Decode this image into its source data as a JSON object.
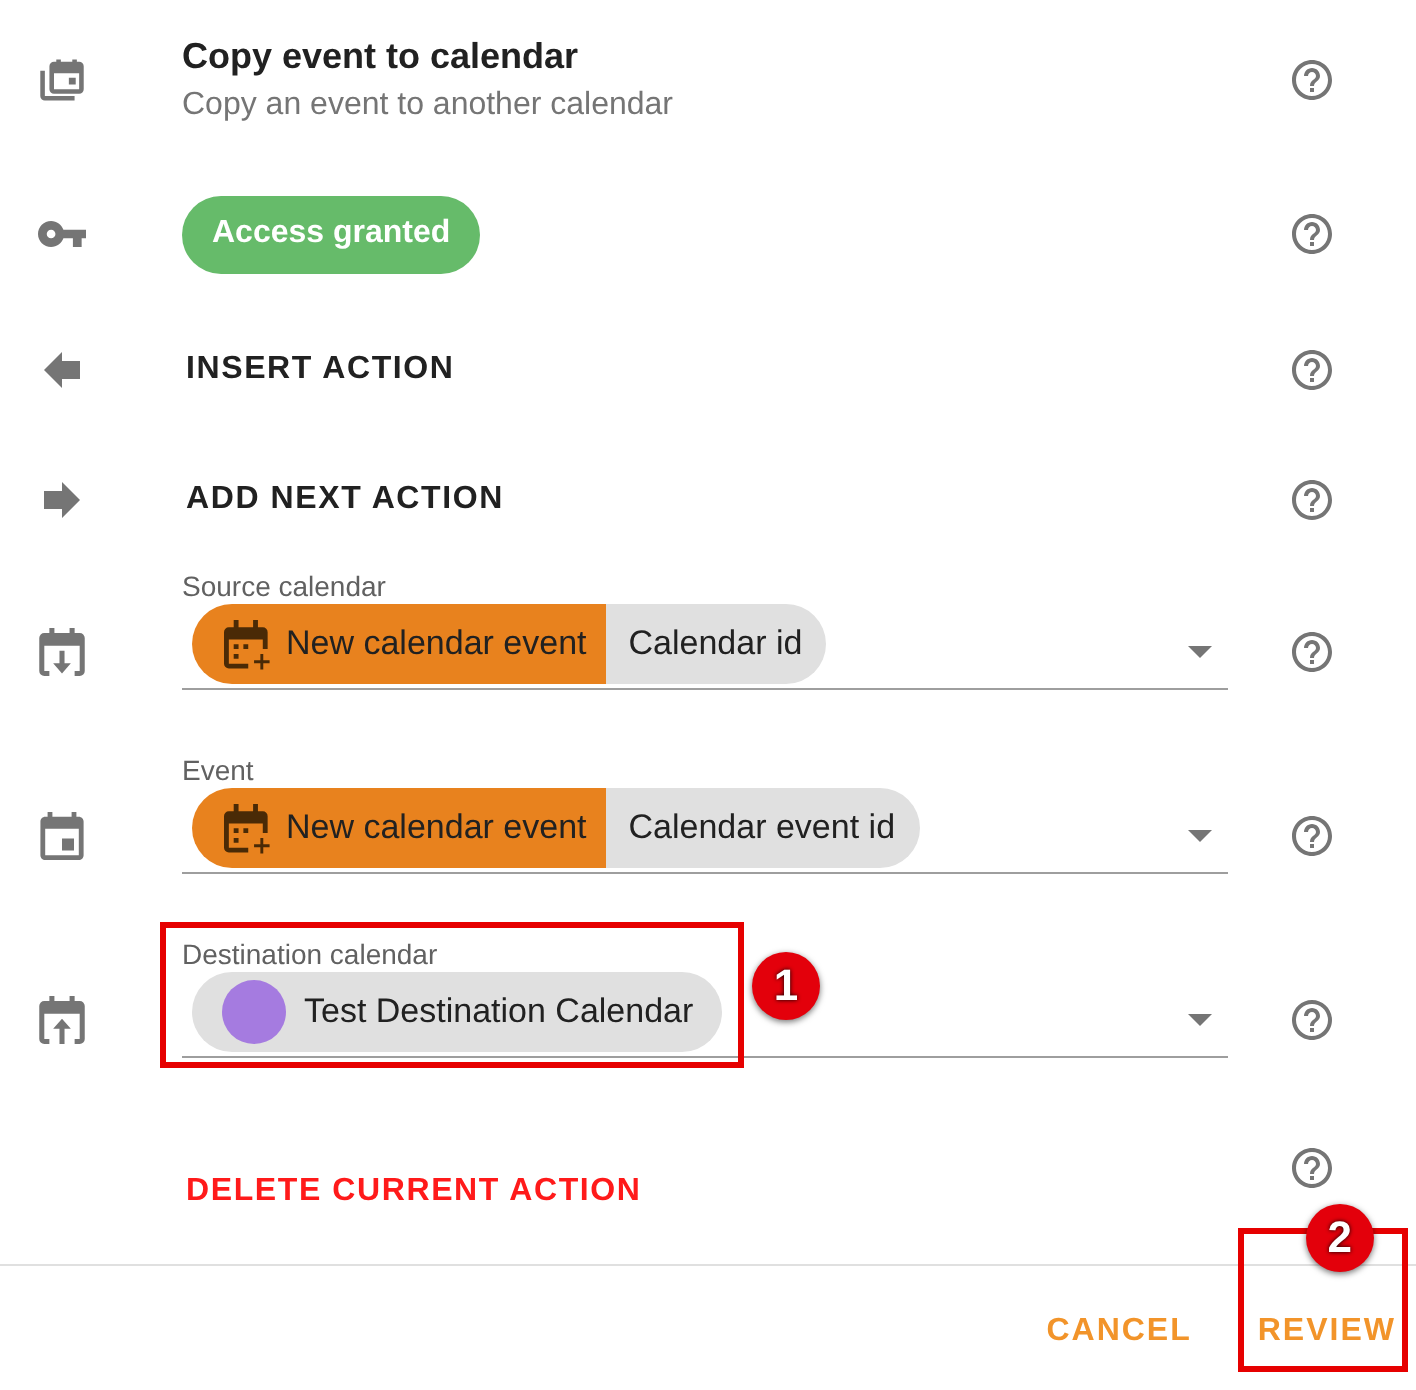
{
  "header": {
    "title": "Copy event to calendar",
    "subtitle": "Copy an event to another calendar"
  },
  "access": {
    "label": "Access granted"
  },
  "insert_action": {
    "label": "INSERT ACTION"
  },
  "add_next_action": {
    "label": "ADD NEXT ACTION"
  },
  "fields": [
    {
      "label": "Source calendar",
      "highlighted": false,
      "chips": [
        {
          "kind": "trigger",
          "text": "New calendar event"
        },
        {
          "kind": "value",
          "text": "Calendar id"
        }
      ]
    },
    {
      "label": "Event",
      "highlighted": false,
      "chips": [
        {
          "kind": "trigger",
          "text": "New calendar event"
        },
        {
          "kind": "value",
          "text": "Calendar event id"
        }
      ]
    },
    {
      "label": "Destination calendar",
      "highlighted": true,
      "marker": "1",
      "chips": [
        {
          "kind": "calendar",
          "text": "Test Destination Calendar",
          "color": "#a57be0"
        }
      ]
    }
  ],
  "delete_action": {
    "label": "DELETE CURRENT ACTION"
  },
  "footer": {
    "buttons": [
      {
        "label": "CANCEL",
        "highlighted": false
      },
      {
        "label": "REVIEW",
        "highlighted": true,
        "marker": "2"
      }
    ]
  }
}
